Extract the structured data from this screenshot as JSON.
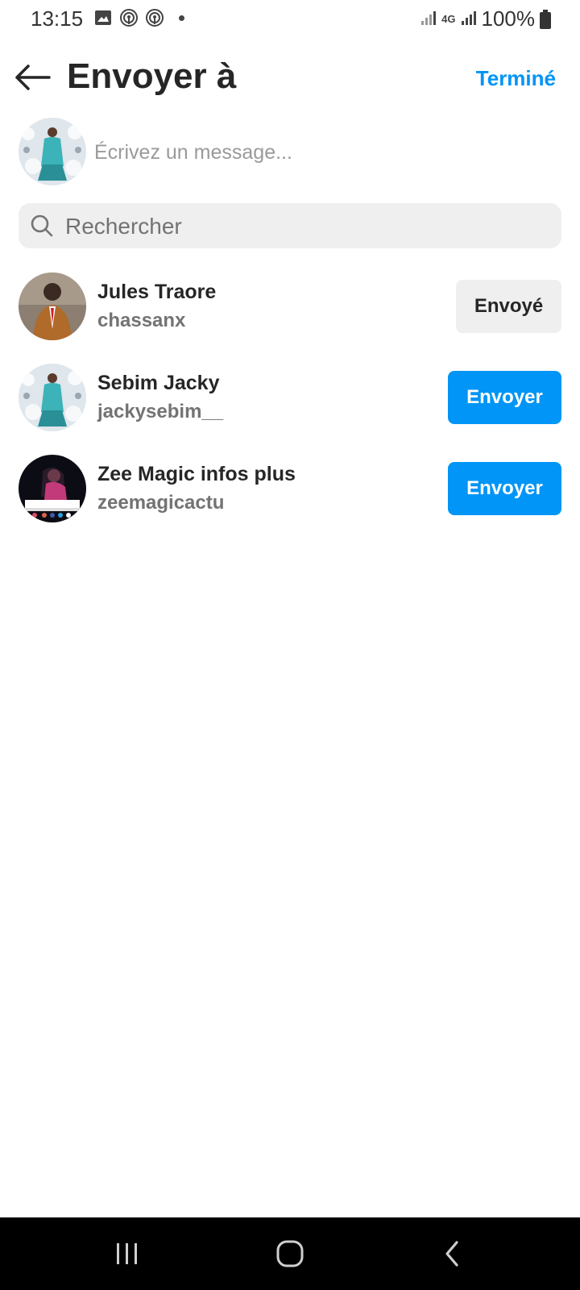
{
  "status_bar": {
    "time": "13:15",
    "battery": "100%",
    "network": "4G",
    "icons": [
      "image-icon",
      "podcast-icon",
      "podcast-icon",
      "dot-icon",
      "signal-icon",
      "signal-icon",
      "battery-icon"
    ]
  },
  "header": {
    "title": "Envoyer à",
    "done_label": "Terminé"
  },
  "composer": {
    "placeholder": "Écrivez un message..."
  },
  "search": {
    "placeholder": "Rechercher"
  },
  "contacts": [
    {
      "name": "Jules Traore",
      "username": "chassanx",
      "button_label": "Envoyé",
      "state": "sent"
    },
    {
      "name": "Sebim Jacky",
      "username": "jackysebim__",
      "button_label": "Envoyer",
      "state": "unsent"
    },
    {
      "name": "Zee Magic infos plus",
      "username": "zeemagicactu",
      "button_label": "Envoyer",
      "state": "unsent"
    }
  ],
  "avatar_logo_text": "ZEE MAGIC INFOS PLUS",
  "colors": {
    "accent": "#0095f6",
    "text_primary": "#262626",
    "text_secondary": "#737373",
    "button_sent_bg": "#efefef",
    "nav_bar_bg": "#000000"
  }
}
